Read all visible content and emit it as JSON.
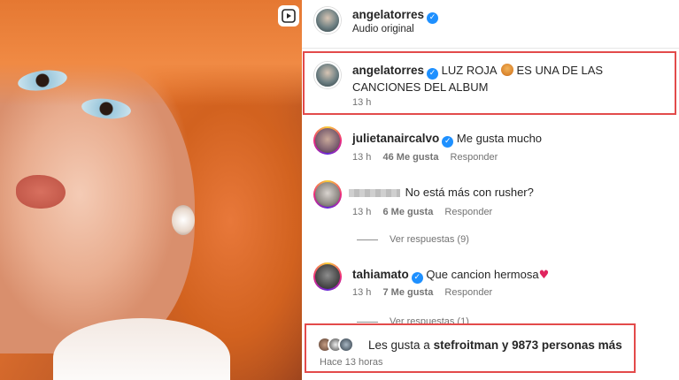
{
  "post": {
    "author": "angelatorres",
    "audio": "Audio original"
  },
  "caption": {
    "username": "angelatorres",
    "text_a": "LUZ ROJA",
    "text_b": "ES UNA DE LAS CANCIONES DEL",
    "text_c": "ALBUM",
    "time": "13 h"
  },
  "comments": [
    {
      "username": "julietanaircalvo",
      "text": "Me gusta mucho",
      "time": "13 h",
      "likes": "46 Me gusta",
      "reply": "Responder",
      "replies": ""
    },
    {
      "username": "",
      "text": "No está más con rusher?",
      "time": "13 h",
      "likes": "6 Me gusta",
      "reply": "Responder",
      "replies": "Ver respuestas (9)"
    },
    {
      "username": "tahiamato",
      "text": "Que cancion hermosa",
      "time": "13 h",
      "likes": "7 Me gusta",
      "reply": "Responder",
      "replies": "Ver respuestas (1)"
    }
  ],
  "likes_summary": {
    "prefix": "Les gusta a",
    "user": "stefroitman",
    "suffix": "y 9873 personas más",
    "time": "Hace 13 horas"
  },
  "icons": {
    "verified": "verified-badge-icon",
    "reel": "reel-play-icon",
    "heart": "red-heart-emoji",
    "emoji": "face-emoji"
  },
  "colors": {
    "highlight_box": "#e34b4b",
    "verified": "#1e90ff",
    "heart": "#e0245e"
  }
}
